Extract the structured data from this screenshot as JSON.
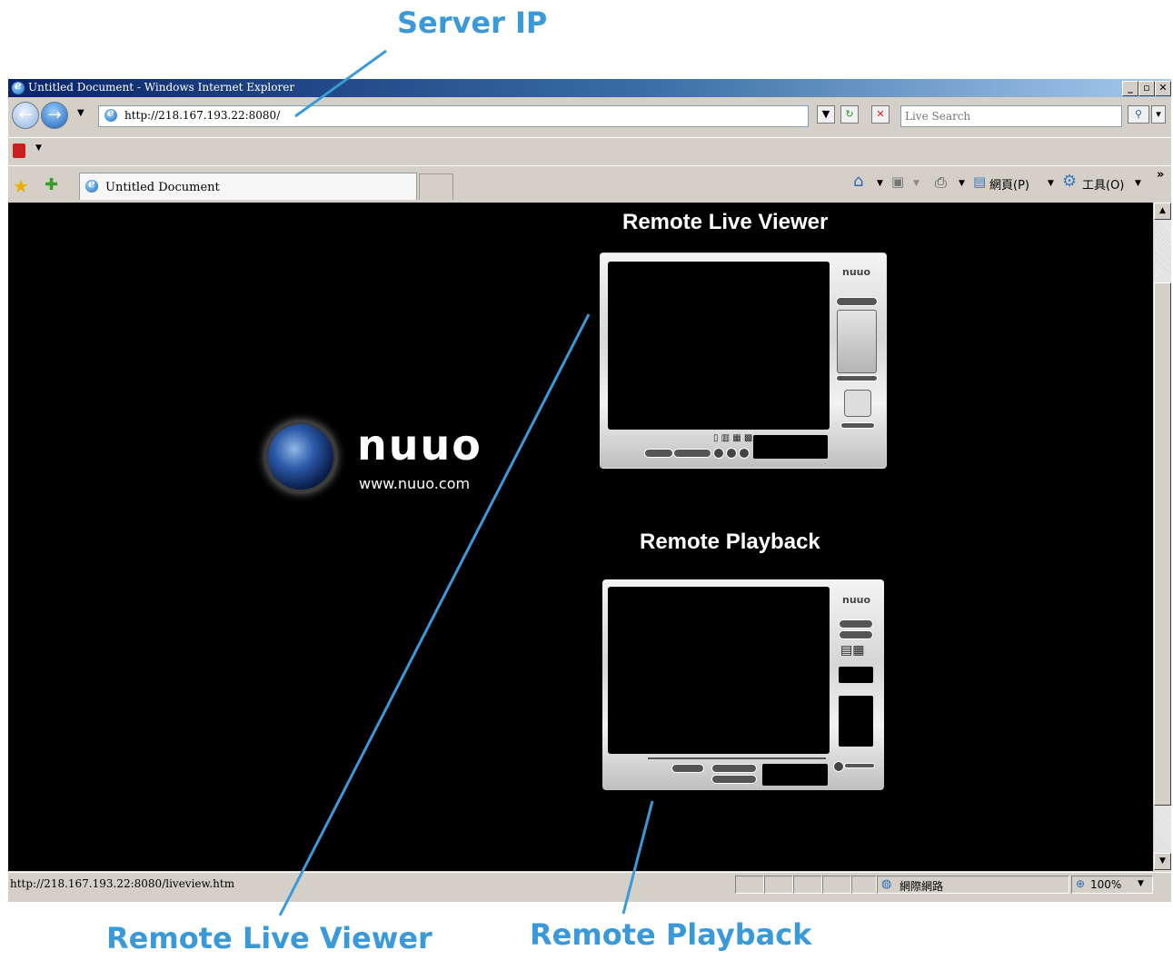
{
  "callouts": {
    "server_ip": "Server IP",
    "remote_live_viewer": "Remote Live Viewer",
    "remote_playback": "Remote Playback",
    "color": "#3a9ad9"
  },
  "browser": {
    "title": "Untitled Document - Windows Internet Explorer",
    "address": "http://218.167.193.22:8080/",
    "search_placeholder": "Live Search",
    "tab_label": "Untitled Document",
    "toolbar": {
      "webpage_label": "網頁(P)",
      "tools_label": "工具(O)"
    },
    "window_buttons": [
      "_",
      "▫",
      "✕"
    ]
  },
  "page": {
    "live_viewer_heading": "Remote Live Viewer",
    "playback_heading": "Remote Playback",
    "brand": "nuuo",
    "website": "www.nuuo.com",
    "viewer_logo": "nuuo"
  },
  "status": {
    "url": "http://218.167.193.22:8080/liveview.htm",
    "zone": "網際網路",
    "zoom": "100%"
  },
  "icons": [
    "ie-icon",
    "back-icon",
    "forward-icon",
    "refresh-icon",
    "stop-icon",
    "search-icon",
    "favorites-star-icon",
    "add-favorites-icon",
    "home-icon",
    "feeds-icon",
    "print-icon",
    "page-icon",
    "tools-gear-icon",
    "globe-icon",
    "zoom-icon"
  ]
}
